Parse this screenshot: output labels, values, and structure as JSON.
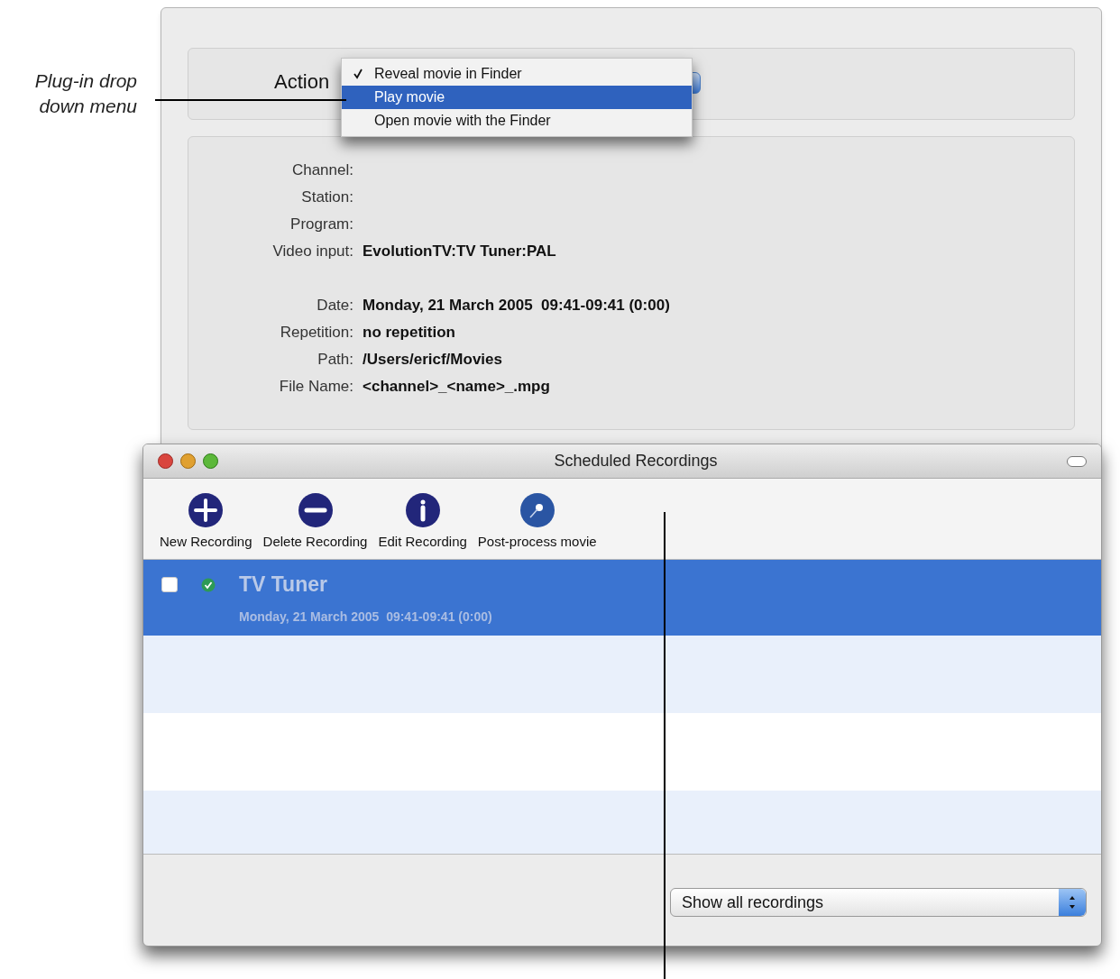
{
  "annotations": [
    {
      "text": "Plug-in drop down menu"
    }
  ],
  "settings_window": {
    "action_label": "Action",
    "menu": [
      {
        "label": "Reveal movie in Finder",
        "checked": true,
        "selected": false
      },
      {
        "label": "Play movie",
        "checked": false,
        "selected": true
      },
      {
        "label": "Open movie with the Finder",
        "checked": false,
        "selected": false
      }
    ],
    "field_groups": [
      {
        "fields": [
          {
            "label": "Channel:"
          },
          {
            "label": "Station:"
          },
          {
            "label": "Program:"
          },
          {
            "label": "Video input:",
            "value": "EvolutionTV:TV Tuner:PAL"
          }
        ]
      },
      {
        "fields": [
          {
            "label": "Date:",
            "value": "Monday, 21 March 2005  09:41-09:41 (0:00)"
          },
          {
            "label": "Repetition:",
            "value": "no repetition"
          },
          {
            "label": "Path:",
            "value": "/Users/ericf/Movies"
          },
          {
            "label": "File Name:",
            "value": "<channel>_<name>_.mpg"
          }
        ]
      }
    ]
  },
  "recordings_window": {
    "title": "Scheduled Recordings",
    "toolbar": [
      {
        "kind": "plus",
        "label": "New Recording"
      },
      {
        "kind": "minus",
        "label": "Delete Recording"
      },
      {
        "kind": "info",
        "label": "Edit Recording"
      },
      {
        "kind": "pin",
        "label": "Post-process movie"
      }
    ],
    "rows": [
      {
        "title": "TV Tuner",
        "subtitle": "Monday, 21 March 2005  09:41-09:41 (0:00)",
        "selected": true,
        "checked": false
      }
    ],
    "filter": {
      "value": "Show all recordings"
    }
  }
}
